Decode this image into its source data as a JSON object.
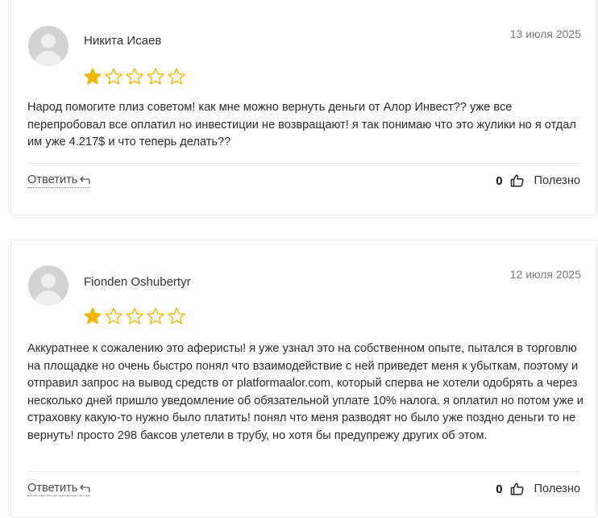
{
  "colors": {
    "star_filled": "#f2b705",
    "star_empty_stroke": "#f2b705",
    "avatar_bg": "#d2d2d2"
  },
  "reviews": [
    {
      "author": "Никита Исаев",
      "date": "13 июля 2025",
      "rating": 1,
      "rating_max": 5,
      "text": "Народ помогите плиз советом! как мне можно вернуть деньги от Алор Инвест?? уже все перепробовал все оплатил но инвестиции не возвращают! я так понимаю что это жулики но я отдал им уже 4.217$ и что теперь делать??",
      "reply_label": "Ответить",
      "vote_count": "0",
      "useful_label": "Полезно"
    },
    {
      "author": "Fionden Oshubertyr",
      "date": "12 июля 2025",
      "rating": 1,
      "rating_max": 5,
      "text": "Аккуратнее к сожалению это аферисты! я уже узнал это на собственном опыте, пытался в торговлю на площадке но очень быстро понял что взаимодействие с ней приведет меня к убыткам, поэтому и отправил запрос на вывод средств от platformaalor.com, который сперва не хотели одобрять а через несколько дней пришло уведомление об обязательной уплате 10% налога. я оплатил но потом уже и страховку какую-то нужно было платить! понял что меня разводят но было уже поздно деньги то не вернуть! просто 298 баксов улетели в трубу, но хотя бы предупрежу других об этом.",
      "reply_label": "Ответить",
      "vote_count": "0",
      "useful_label": "Полезно"
    }
  ]
}
